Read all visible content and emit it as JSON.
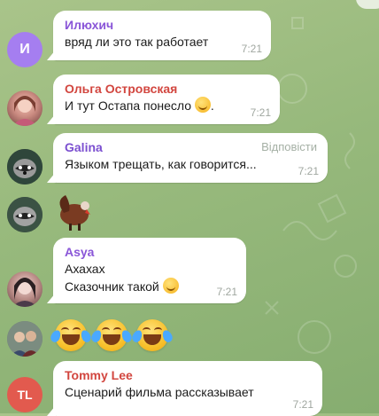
{
  "messages": [
    {
      "author": "Илюхич",
      "author_color": "#8a56d8",
      "avatar_letter": "И",
      "avatar_color": "#a57ef0",
      "text": "вряд ли это так работает",
      "time": "7:21"
    },
    {
      "author": "Ольга Островская",
      "author_color": "#d2463f",
      "avatar": "photo",
      "text": "И тут Остапа понесло",
      "emoji": "smile",
      "time": "7:21"
    },
    {
      "author": "Galina",
      "author_color": "#7b4fd0",
      "avatar": "raccoon-photo",
      "text": "Языком трещать, как говорится...",
      "reply_label": "Відповісти",
      "time": "7:21"
    },
    {
      "sticker": "turkey",
      "avatar": "raccoon-photo"
    },
    {
      "author": "Asya",
      "author_color": "#8a56d8",
      "avatar": "photo",
      "lines": [
        "Ахахах",
        "Сказочник такой"
      ],
      "emoji": "smile",
      "time": "7:21"
    },
    {
      "emojis": [
        "face-with-tears-of-joy",
        "face-with-tears-of-joy",
        "face-with-tears-of-joy"
      ],
      "avatar": "couple-photo"
    },
    {
      "author": "Tommy Lee",
      "author_color": "#d2463f",
      "avatar_letter": "TL",
      "avatar_color": "#e25a4e",
      "text": "Сценарий фильма рассказывает",
      "time": "7:21"
    }
  ]
}
